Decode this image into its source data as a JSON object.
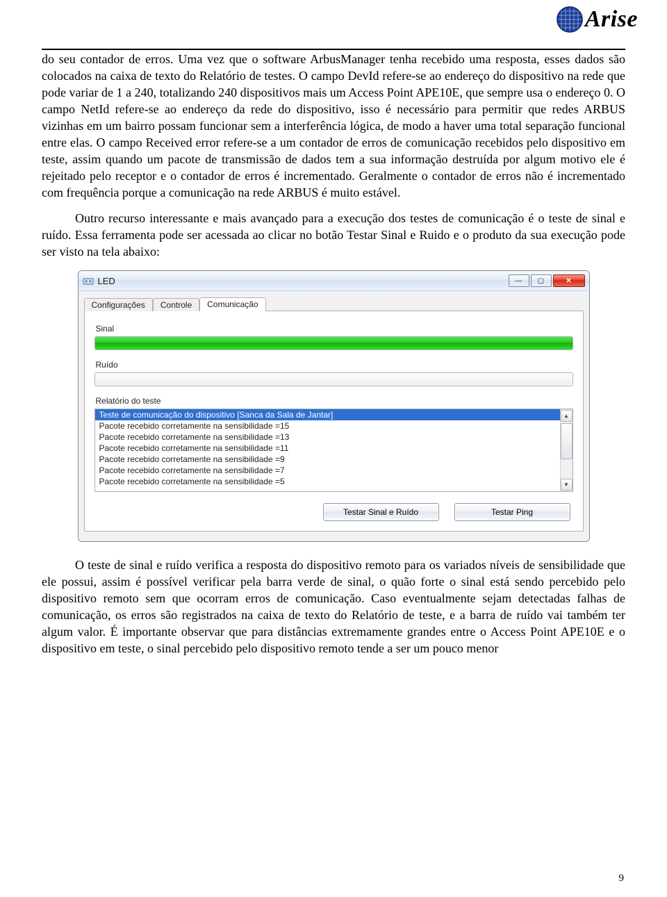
{
  "logo_text": "Arise",
  "paragraphs": {
    "p1": "do seu contador de erros. Uma vez que o software ArbusManager tenha recebido uma resposta, esses dados são colocados na caixa de texto do Relatório de testes. O campo DevId refere-se ao endereço do dispositivo na rede que pode variar de 1 a 240, totalizando 240 dispositivos mais um Access Point APE10E, que sempre usa o endereço 0. O campo NetId refere-se ao endereço da rede do dispositivo, isso é necessário para permitir que redes ARBUS vizinhas em um bairro possam funcionar sem a interferência lógica, de modo a haver uma total separação funcional entre elas. O campo Received error refere-se a um contador de erros de comunicação recebidos pelo dispositivo em teste, assim quando um pacote de transmissão de dados tem a sua informação destruída por algum motivo ele é rejeitado pelo receptor e o contador de erros é incrementado. Geralmente o contador de erros não é incrementado com frequência porque a comunicação na rede ARBUS é muito estável.",
    "p2": "Outro recurso interessante e mais avançado para a execução dos testes de comunicação é o teste de sinal e ruído. Essa ferramenta pode ser acessada ao clicar no botão Testar Sinal e Ruido e o produto da sua execução pode ser visto na tela abaixo:",
    "p3": "O teste de sinal e ruído verifica a resposta do dispositivo remoto para os variados níveis de sensibilidade que ele possui, assim é possível verificar pela barra verde de sinal, o quão forte o sinal está sendo percebido pelo dispositivo remoto sem que ocorram erros de comunicação. Caso eventualmente sejam detectadas falhas de comunicação, os erros são registrados na caixa de texto do Relatório de teste, e a barra de ruído vai também ter algum valor. É importante observar que para distâncias extremamente grandes entre o Access Point APE10E e o dispositivo em teste, o sinal percebido pelo dispositivo remoto tende a ser um pouco menor"
  },
  "dialog": {
    "title": "LED",
    "tabs": [
      "Configurações",
      "Controle",
      "Comunicação"
    ],
    "active_tab": "Comunicação",
    "labels": {
      "sinal": "Sinal",
      "ruido": "Ruído",
      "relatorio": "Relatório do teste"
    },
    "report_rows": [
      "Teste de comunicação do dispositivo [Sanca da Sala de Jantar]",
      "Pacote recebido corretamente na sensibilidade =15",
      "Pacote recebido corretamente na sensibilidade =13",
      "Pacote recebido corretamente na sensibilidade =11",
      "Pacote recebido corretamente na sensibilidade =9",
      "Pacote recebido corretamente na sensibilidade =7",
      "Pacote recebido corretamente na sensibilidade =5"
    ],
    "buttons": {
      "testar_sinal": "Testar Sinal e Ruído",
      "testar_ping": "Testar Ping"
    },
    "win_controls": {
      "min": "—",
      "max": "▢",
      "close": "✕"
    }
  },
  "page_number": "9"
}
